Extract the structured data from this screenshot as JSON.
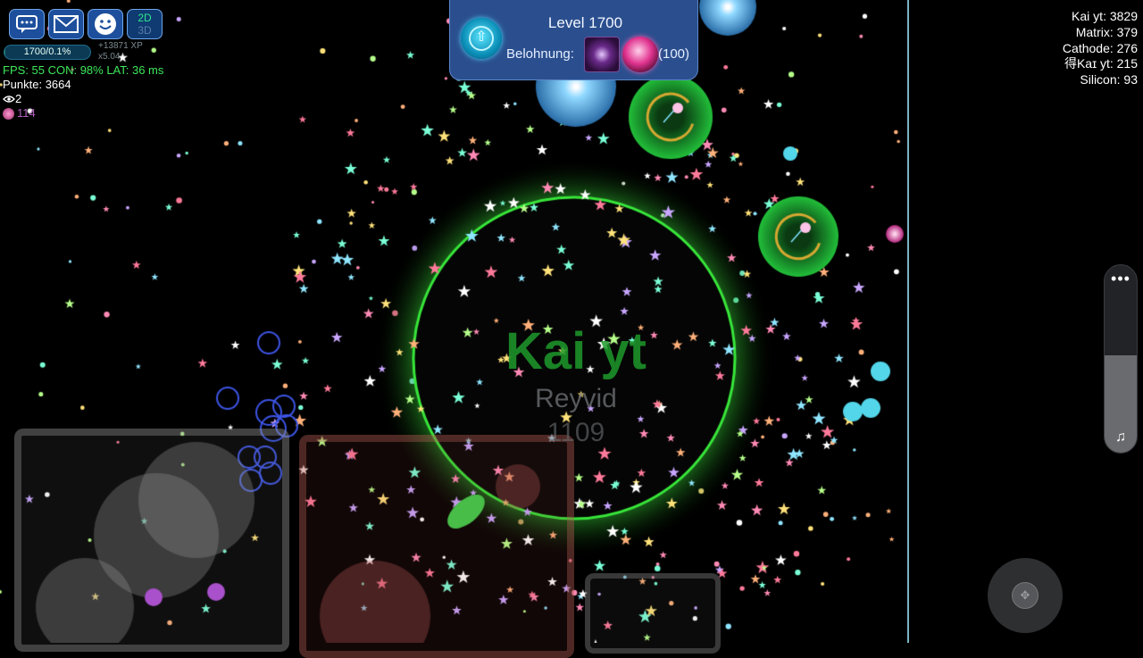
{
  "hud": {
    "chat_icon": "chat-bubble-icon",
    "mail_icon": "envelope-icon",
    "emoji_icon": "smiley-icon",
    "view_2d": "2D",
    "view_3d": "3D",
    "xp_text": "1700/0.1%",
    "xp_progress": 0.001,
    "xp_gain": "+13871 XP",
    "xp_multiplier": "x5.04",
    "fps_line": "FPS: 55 CON: 98% LAT: 36 ms",
    "points_line": "Punkte: 3664",
    "spectators": "2",
    "spectators_icon": "eye-icon",
    "coins": "114",
    "coin_icon": "pink-orb-icon"
  },
  "level_panel": {
    "title": "Level 1700",
    "reward_label": "Belohnung:",
    "reward_count": "(100)",
    "level_icon": "level-up-arrow-icon",
    "reward_icons": [
      "purple-skin-icon",
      "pink-orb-icon"
    ]
  },
  "leaderboard": [
    {
      "name": "Kai yt",
      "score": "3829"
    },
    {
      "name": "Matrix",
      "score": "379"
    },
    {
      "name": "Cathode",
      "score": "276"
    },
    {
      "name": "得Kaɪ уt",
      "score": "215"
    },
    {
      "name": "Silicon",
      "score": "93"
    }
  ],
  "player": {
    "name": "Kai yt",
    "clan": "Reyvid",
    "mass": "1109"
  },
  "controls": {
    "menu_icon": "three-dots-icon",
    "sound_icon": "music-note-icon",
    "volume_level": 0.52,
    "joystick_icon": "four-way-arrow-icon"
  },
  "colors": {
    "background": "#000000",
    "player_ring": "#38e63a",
    "hud_button": "#1d4f9c",
    "stats_text": "#3ee85a",
    "panel": "#2b4f8e"
  }
}
